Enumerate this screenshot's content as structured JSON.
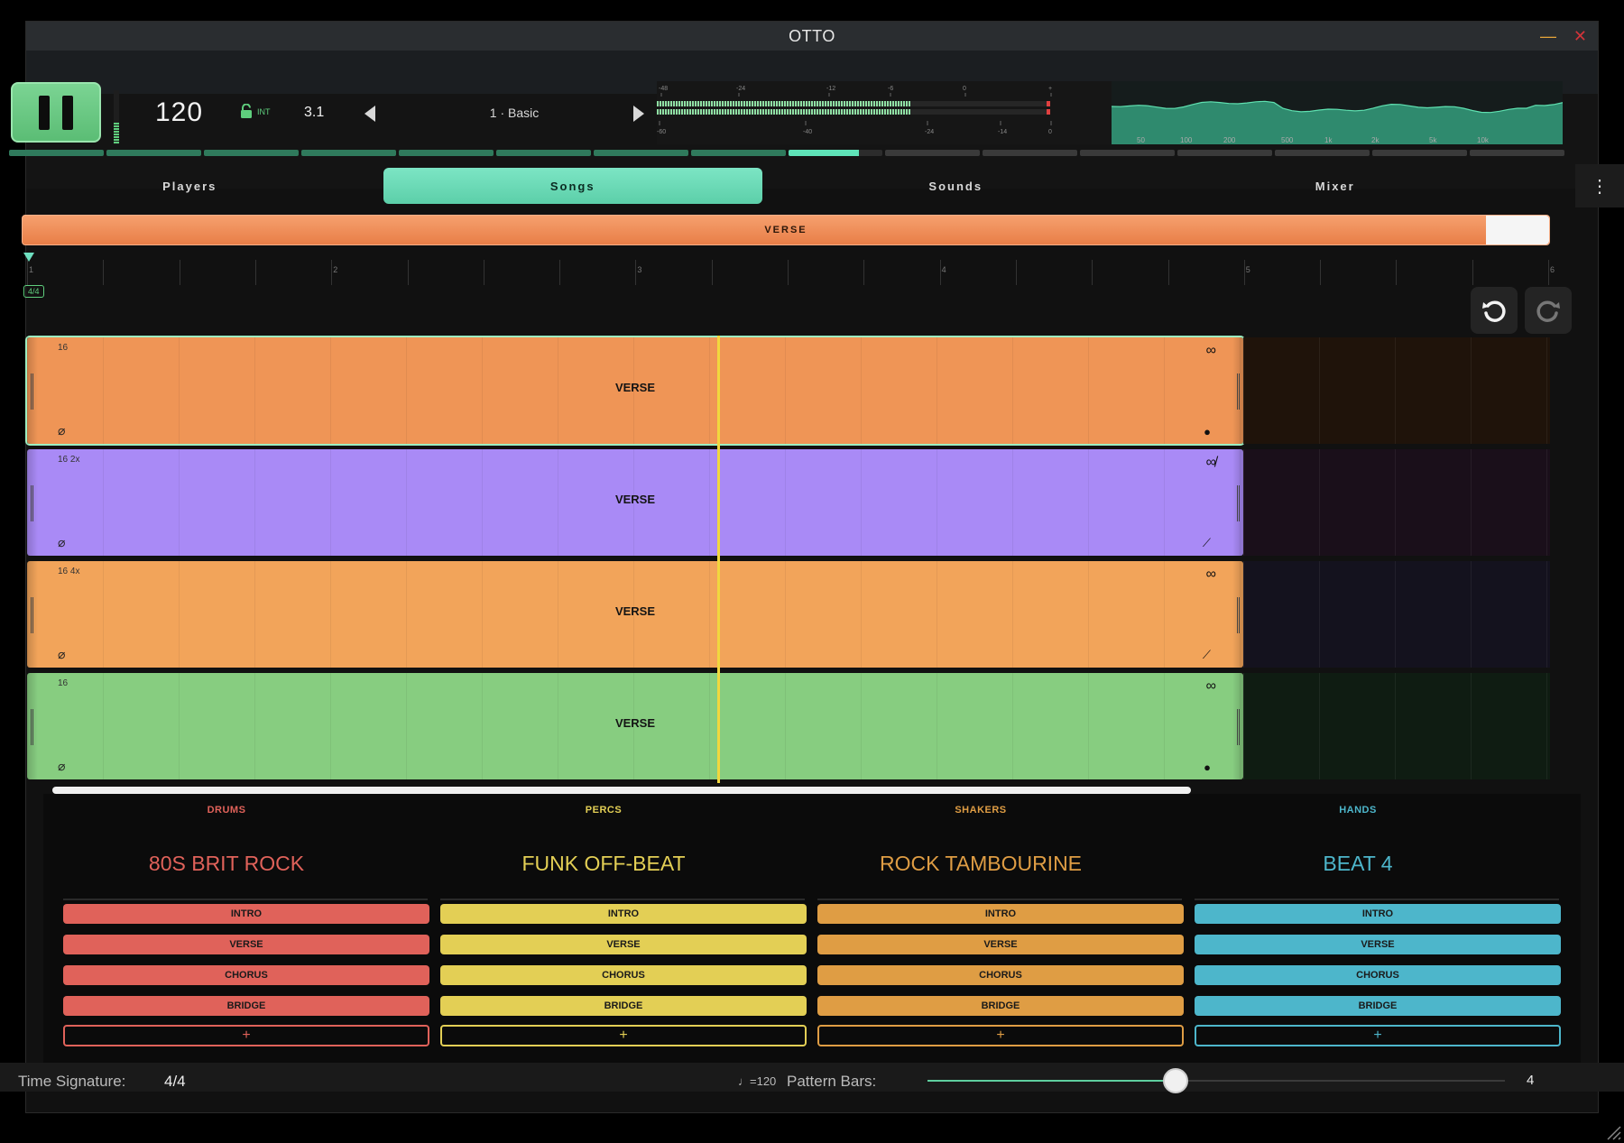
{
  "window": {
    "title": "OTTO"
  },
  "transport": {
    "tempo": "120",
    "sync_label": "INT",
    "position": "3.1",
    "pattern": "1 · Basic",
    "meter_scale_top": [
      "-48",
      "-24",
      "-12",
      "-6",
      "0",
      "+"
    ],
    "meter_scale_bottom": [
      "-60",
      "-40",
      "-24",
      "-14",
      "0"
    ],
    "spectrum_scale": [
      "50",
      "100",
      "200",
      "500",
      "1k",
      "2k",
      "5k",
      "10k"
    ],
    "song_progress": {
      "segments": 16,
      "completed": 8,
      "current_fill": 0.75
    }
  },
  "tabs": [
    {
      "label": "Players",
      "active": false
    },
    {
      "label": "Songs",
      "active": true
    },
    {
      "label": "Sounds",
      "active": false
    },
    {
      "label": "Mixer",
      "active": false
    }
  ],
  "menu_icon": "more-vertical-icon",
  "song": {
    "section_label": "VERSE",
    "ruler_numbers": [
      "1",
      "2",
      "3",
      "4",
      "5",
      "6"
    ],
    "time_signature_badge": "4/4",
    "undo_icon": "undo-icon",
    "redo_icon": "redo-icon",
    "lanes": [
      {
        "label": "VERSE",
        "length": "16",
        "color": "#ef9556",
        "rest": "#1f130a",
        "loop": "∞",
        "end": "●"
      },
      {
        "label": "VERSE",
        "length": "16 2x",
        "color": "#a98af6",
        "rest": "#1a0f1a",
        "loop": "∞̸",
        "end": "⟋"
      },
      {
        "label": "VERSE",
        "length": "16 4x",
        "color": "#f2a45a",
        "rest": "#14121e",
        "loop": "∞",
        "end": "⟋"
      },
      {
        "label": "VERSE",
        "length": "16",
        "color": "#87cd80",
        "rest": "#0f1c12",
        "loop": "∞",
        "end": "●"
      }
    ]
  },
  "players": [
    {
      "name": "DRUMS",
      "pattern": "80S BRIT ROCK",
      "color": "#e0625a",
      "sections": [
        "INTRO",
        "VERSE",
        "CHORUS",
        "BRIDGE"
      ],
      "add": "+"
    },
    {
      "name": "PERCS",
      "pattern": "FUNK OFF-BEAT",
      "color": "#e3cf55",
      "sections": [
        "INTRO",
        "VERSE",
        "CHORUS",
        "BRIDGE"
      ],
      "add": "+"
    },
    {
      "name": "SHAKERS",
      "pattern": "ROCK TAMBOURINE",
      "color": "#df9d44",
      "sections": [
        "INTRO",
        "VERSE",
        "CHORUS",
        "BRIDGE"
      ],
      "add": "+"
    },
    {
      "name": "HANDS",
      "pattern": "BEAT 4",
      "color": "#4db6cb",
      "sections": [
        "INTRO",
        "VERSE",
        "CHORUS",
        "BRIDGE"
      ],
      "add": "+"
    }
  ],
  "footer": {
    "time_signature_label": "Time Signature:",
    "time_signature_value": "4/4",
    "note_tempo": "♩=120",
    "pattern_bars_label": "Pattern Bars:",
    "pattern_bars_value": "4",
    "pattern_bars_slider_fraction": 0.43
  }
}
